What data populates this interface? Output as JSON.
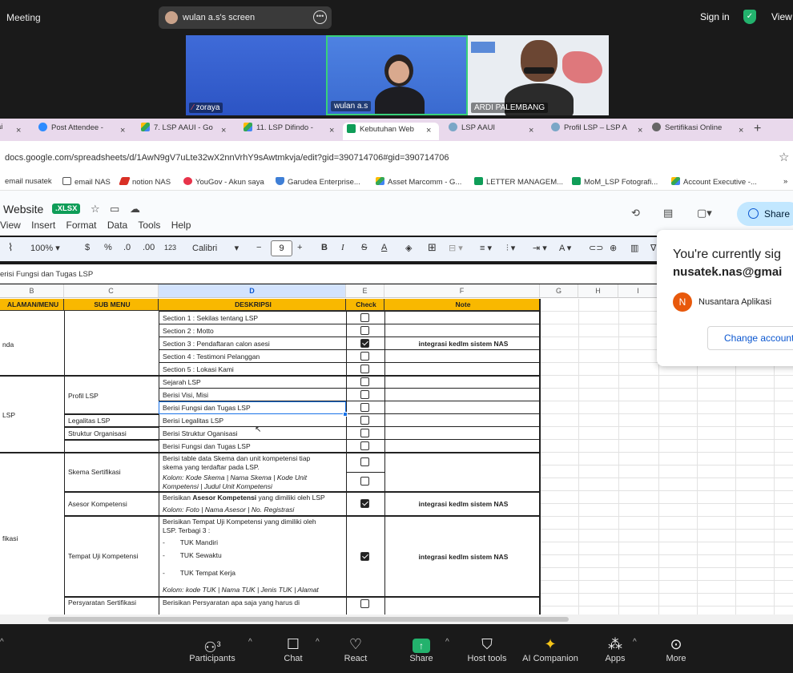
{
  "zoom": {
    "meeting_label": "Meeting",
    "screen_owner": "wulan a.s's screen",
    "sign_in": "Sign in",
    "view": "View",
    "participants": [
      {
        "name": "zoraya"
      },
      {
        "name": "wulan a.s"
      },
      {
        "name": "ARDI PALEMBANG"
      }
    ],
    "participant_count": "3",
    "controls": [
      "Participants",
      "Chat",
      "React",
      "Share",
      "Host tools",
      "AI Companion",
      "Apps",
      "More"
    ]
  },
  "browser": {
    "tabs": [
      {
        "label": "ai"
      },
      {
        "label": "Post Attendee - "
      },
      {
        "label": "7. LSP AAUI - Go"
      },
      {
        "label": "11. LSP Difindo -"
      },
      {
        "label": "Kebutuhan Web"
      },
      {
        "label": "LSP AAUI"
      },
      {
        "label": "Profil LSP – LSP A"
      },
      {
        "label": "Sertifikasi Online"
      }
    ],
    "url": "docs.google.com/spreadsheets/d/1AwN9gV7uLte32wX2nnVrhY9sAwtmkvja/edit?gid=390714706#gid=390714706",
    "bookmarks": [
      "email nusatek",
      "email NAS",
      "notion NAS",
      "YouGov - Akun saya",
      "Garudea Enterprise...",
      "Asset Marcomm - G...",
      "LETTER MANAGEM...",
      "MoM_LSP Fotografi...",
      "Account Executive -..."
    ],
    "bookmarks_more": "»"
  },
  "sheet": {
    "title": "Website",
    "badge": ".XLSX",
    "menus": [
      "View",
      "Insert",
      "Format",
      "Data",
      "Tools",
      "Help"
    ],
    "share_label": "Share",
    "zoom_level": "100%",
    "currency": "$",
    "percent": "%",
    "dec_less": ".0",
    "dec_more": ".00",
    "num_format": "123",
    "font": "Calibri",
    "font_size": "9",
    "formula_value": "erisi Fungsi dan Tugas LSP",
    "columns": [
      "B",
      "C",
      "D",
      "E",
      "F",
      "G",
      "H",
      "I"
    ],
    "headers": {
      "b": "ALAMAN/MENU",
      "c": "SUB MENU",
      "d": "DESKRIPSI",
      "e": "Check",
      "f": "Note"
    },
    "b_labels": {
      "r1": "nda",
      "r2": "LSP",
      "r3": "fikasi"
    },
    "c_labels": {
      "profil": "Profil LSP",
      "legalitas": "Legalitas LSP",
      "struktur": "Struktur Organisasi",
      "skema": "Skema Sertifikasi",
      "asesor": "Asesor Kompetensi",
      "tuk": "Tempat Uji Kompetensi",
      "persyaratan": "Persyaratan Sertifikasi"
    },
    "rows": [
      {
        "d": "Section 1 : Sekilas tentang LSP",
        "checked": false,
        "note": ""
      },
      {
        "d": "Section 2 : Motto",
        "checked": false,
        "note": ""
      },
      {
        "d": "Section 3 : Pendaftaran calon asesi",
        "checked": true,
        "note": "integrasi kedlm sistem NAS"
      },
      {
        "d": "Section 4 : Testimoni Pelanggan",
        "checked": false,
        "note": ""
      },
      {
        "d": "Section 5 : Lokasi Kami",
        "checked": false,
        "note": ""
      },
      {
        "d": "Sejarah LSP",
        "checked": false,
        "note": ""
      },
      {
        "d": "Berisi Visi, Misi",
        "checked": false,
        "note": ""
      },
      {
        "d": "Berisi Fungsi dan Tugas LSP",
        "checked": false,
        "note": ""
      },
      {
        "d": "Berisi Legalitas LSP",
        "checked": false,
        "note": ""
      },
      {
        "d": "Berisi Struktur Oganisasi",
        "checked": false,
        "note": ""
      },
      {
        "d": "Berisi Fungsi dan Tugas LSP",
        "checked": false,
        "note": ""
      }
    ],
    "skema": {
      "l1": "Berisi table data Skema dan unit kompetensi tiap",
      "l2": "skema yang terdaftar pada LSP.",
      "l3": "Kolom: Kode Skema | Nama Skema | Kode Unit",
      "l4": "Kompetensi | Judul Unit Kompetensi"
    },
    "asesor": {
      "l1a": "Berisikan ",
      "l1b": "Asesor Kompetensi",
      "l1c": " yang dimiliki oleh LSP",
      "l2": "Kolom: Foto | Nama Asesor | No. Registrasi",
      "note": "integrasi kedlm sistem NAS",
      "checked": true
    },
    "tuk": {
      "l1": "Berisikan Tempat Uji Kompetensi yang dimiliki oleh",
      "l2": "LSP. Terbagi 3 :",
      "b1": "TUK Mandiri",
      "b2": "TUK Sewaktu",
      "b3": "TUK Tempat Kerja",
      "l3": "Kolom: kode TUK | Nama TUK | Jenis TUK | Alamat",
      "note": "integrasi kedlm sistem NAS",
      "checked": true
    },
    "persyaratan": {
      "l1": "Berisikan Persyaratan apa saja yang harus di"
    }
  },
  "account_popup": {
    "line1": "You're currently sig",
    "line2": "nusatek.nas@gmai",
    "account_name": "Nusantara Aplikasi",
    "avatar_letter": "N",
    "change": "Change account"
  },
  "colors": {
    "header_yellow": "#f9b800",
    "zoom_green": "#23b26d",
    "sheets_green": "#0f9d58"
  }
}
